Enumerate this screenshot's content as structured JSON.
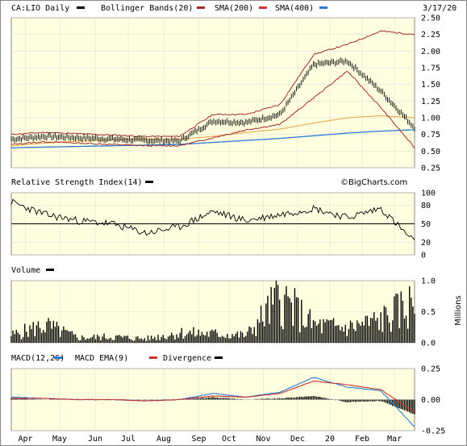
{
  "date_label": "3/17/20",
  "watermark": "©BigCharts.com",
  "colors": {
    "background": "#ffffe0",
    "price": "#000000",
    "bollinger": "#a52a2a",
    "sma200": "#cc3333",
    "sma400": "#e6a040",
    "rsi": "#000000",
    "volume": "#000000",
    "macd": "#2a7ad5",
    "macd_ema": "#cc3333",
    "divergence": "#000000"
  },
  "months": [
    "Apr",
    "May",
    "Jun",
    "Jul",
    "Aug",
    "Sep",
    "Oct",
    "Nov",
    "Dec",
    "20",
    "Feb",
    "Mar"
  ],
  "chart_data": [
    {
      "type": "line",
      "title": "CA:LIO Daily",
      "legend": [
        {
          "label": "CA:LIO Daily",
          "color": "#000000"
        },
        {
          "label": "Bollinger Bands(20)",
          "color": "#a52a2a"
        },
        {
          "label": "SMA(200)",
          "color": "#cc3333"
        },
        {
          "label": "SMA(400)",
          "color": "#2a7ad5"
        }
      ],
      "ylim": [
        0.25,
        2.5
      ],
      "yticks": [
        "2.50",
        "2.25",
        "2.00",
        "1.75",
        "1.50",
        "1.25",
        "1.00",
        "0.75",
        "0.50",
        "0.25"
      ],
      "x": [
        "Apr",
        "May",
        "Jun",
        "Jul",
        "Aug",
        "Sep",
        "Oct",
        "Nov",
        "Dec",
        "20",
        "Feb",
        "Mar",
        "3/17"
      ],
      "series": [
        {
          "name": "CA:LIO Daily",
          "values": [
            0.68,
            0.72,
            0.7,
            0.68,
            0.66,
            0.65,
            0.95,
            0.93,
            1.05,
            1.8,
            1.85,
            1.4,
            0.85
          ]
        },
        {
          "name": "Bollinger Bands(20)",
          "upper": [
            0.75,
            0.78,
            0.76,
            0.74,
            0.72,
            0.72,
            1.05,
            1.05,
            1.2,
            1.95,
            2.1,
            2.3,
            2.25
          ],
          "lower": [
            0.6,
            0.64,
            0.62,
            0.6,
            0.58,
            0.58,
            0.7,
            0.82,
            0.9,
            1.3,
            1.7,
            1.15,
            0.55
          ]
        },
        {
          "name": "SMA(200)",
          "values": [
            0.58,
            0.62,
            0.65,
            0.67,
            0.68,
            0.68,
            0.72,
            0.78,
            0.83,
            0.92,
            1.0,
            1.03,
            1.0
          ]
        },
        {
          "name": "SMA(400)",
          "values": [
            0.55,
            0.56,
            0.57,
            0.58,
            0.59,
            0.6,
            0.63,
            0.66,
            0.69,
            0.73,
            0.77,
            0.8,
            0.82
          ]
        }
      ]
    },
    {
      "type": "line",
      "title": "Relative Strength Index(14)",
      "ylim": [
        0,
        100
      ],
      "yticks": [
        "100",
        "80",
        "50",
        "20",
        "0"
      ],
      "reference_line": 50,
      "x": [
        "Apr",
        "May",
        "Jun",
        "Jul",
        "Aug",
        "Sep",
        "Oct",
        "Nov",
        "Dec",
        "20",
        "Feb",
        "Mar",
        "3/17"
      ],
      "values": [
        85,
        65,
        55,
        50,
        35,
        45,
        70,
        55,
        65,
        75,
        60,
        75,
        20
      ]
    },
    {
      "type": "bar",
      "title": "Volume",
      "ylabel": "Millions",
      "ylim": [
        0,
        1.0
      ],
      "yticks": [
        "1.0",
        "0.5",
        "0.0"
      ],
      "x": [
        "Apr",
        "May",
        "Jun",
        "Jul",
        "Aug",
        "Sep",
        "Oct",
        "Nov",
        "Dec",
        "20",
        "Feb",
        "Mar",
        "3/17"
      ],
      "values": [
        0.15,
        0.35,
        0.1,
        0.12,
        0.08,
        0.2,
        0.18,
        0.15,
        0.9,
        0.35,
        0.3,
        0.45,
        0.8
      ]
    },
    {
      "type": "line",
      "title": "MACD(12,26)",
      "legend": [
        {
          "label": "MACD(12,26)",
          "color": "#000000"
        },
        {
          "label": "MACD EMA(9)",
          "color": "#2a7ad5"
        },
        {
          "label": "Divergence",
          "color": "#cc3333"
        }
      ],
      "ylim": [
        -0.25,
        0.25
      ],
      "yticks": [
        "0.25",
        "0.00",
        "-0.25"
      ],
      "x": [
        "Apr",
        "May",
        "Jun",
        "Jul",
        "Aug",
        "Sep",
        "Oct",
        "Nov",
        "Dec",
        "20",
        "Feb",
        "Mar",
        "3/17"
      ],
      "series": [
        {
          "name": "MACD(12,26)",
          "values": [
            0.02,
            0.01,
            0.0,
            0.0,
            -0.01,
            0.0,
            0.05,
            0.02,
            0.06,
            0.18,
            0.1,
            0.07,
            -0.22
          ]
        },
        {
          "name": "MACD EMA(9)",
          "values": [
            0.01,
            0.01,
            0.0,
            0.0,
            -0.01,
            0.0,
            0.03,
            0.02,
            0.05,
            0.15,
            0.12,
            0.08,
            -0.1
          ]
        },
        {
          "name": "Divergence",
          "values": [
            0.01,
            0.0,
            0.0,
            0.0,
            0.0,
            0.0,
            0.02,
            0.0,
            0.01,
            0.03,
            -0.02,
            -0.01,
            -0.12
          ]
        }
      ]
    }
  ]
}
